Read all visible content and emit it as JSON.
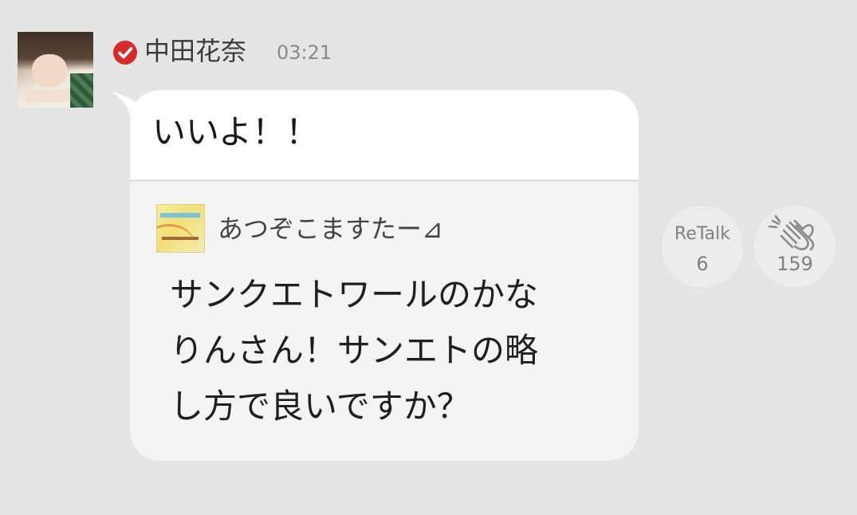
{
  "post": {
    "author": "中田花奈",
    "time": "03:21",
    "message": "いいよ！！"
  },
  "quoted": {
    "user": "あつぞこますたー⊿",
    "text_lines": [
      "サンクエトワールのかな",
      "りんさん！サンエトの略",
      "し方で良いですか？"
    ]
  },
  "actions": {
    "retalk_label": "ReTalk",
    "retalk_count": "6",
    "clap_count": "159"
  },
  "icons": {
    "verified": "verified-check-icon",
    "clap": "clap-hands-icon"
  },
  "colors": {
    "background": "#e5e5e5",
    "verified": "#d62b2b",
    "bubble_top": "#ffffff",
    "bubble_bottom": "#f4f4f4"
  }
}
